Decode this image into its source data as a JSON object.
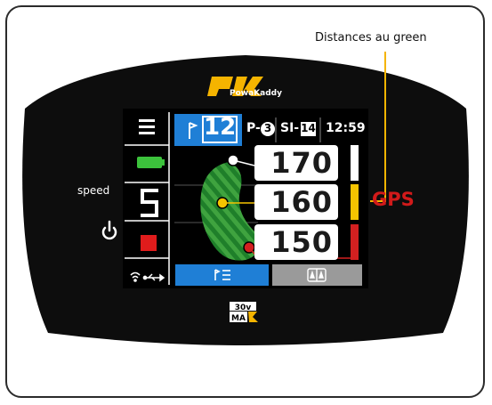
{
  "annotation": {
    "label": "Distances au green"
  },
  "brand": {
    "logo_mark": "PK",
    "name": "PowaKaddy",
    "model_top": "30v",
    "model_bottom": "MAX"
  },
  "controls": {
    "speed_label": "speed",
    "speed_value": "5"
  },
  "header": {
    "hole_number": "12",
    "par_prefix": "P-",
    "par_value": "3",
    "si_prefix": "SI-",
    "si_value": "14",
    "time": "12:59"
  },
  "distances": [
    {
      "value": "170",
      "color": "#ffffff"
    },
    {
      "value": "160",
      "color": "#f5c400"
    },
    {
      "value": "150",
      "color": "#d32020"
    }
  ],
  "gps": {
    "label": "GPS",
    "color": "#d11a1a"
  },
  "bottom_tabs": [
    {
      "name": "scorecard"
    },
    {
      "name": "green-view"
    }
  ],
  "colors": {
    "accent_blue": "#1f7fd6",
    "battery_green": "#3cc23c",
    "stop_red": "#e01c1c",
    "callout_orange": "#f5b400"
  }
}
